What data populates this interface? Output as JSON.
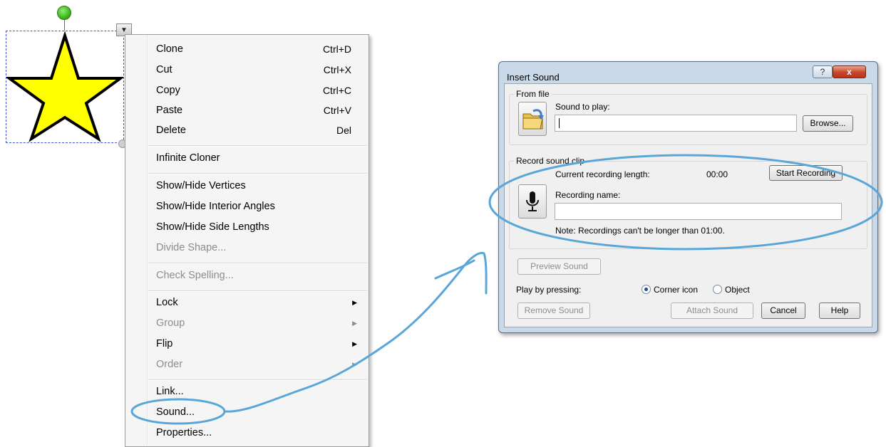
{
  "context_menu": {
    "items": [
      {
        "label": "Clone",
        "shortcut": "Ctrl+D",
        "disabled": false
      },
      {
        "label": "Cut",
        "shortcut": "Ctrl+X",
        "disabled": false
      },
      {
        "label": "Copy",
        "shortcut": "Ctrl+C",
        "disabled": false
      },
      {
        "label": "Paste",
        "shortcut": "Ctrl+V",
        "disabled": false
      },
      {
        "label": "Delete",
        "shortcut": "Del",
        "disabled": false
      },
      {
        "label": "Infinite Cloner",
        "disabled": false
      },
      {
        "label": "Show/Hide Vertices",
        "disabled": false
      },
      {
        "label": "Show/Hide Interior Angles",
        "disabled": false
      },
      {
        "label": "Show/Hide Side Lengths",
        "disabled": false
      },
      {
        "label": "Divide Shape...",
        "disabled": true
      },
      {
        "label": "Check Spelling...",
        "disabled": true
      },
      {
        "label": "Lock",
        "submenu": true,
        "disabled": false
      },
      {
        "label": "Group",
        "submenu": true,
        "disabled": true
      },
      {
        "label": "Flip",
        "submenu": true,
        "disabled": false
      },
      {
        "label": "Order",
        "submenu": true,
        "disabled": true
      },
      {
        "label": "Link...",
        "disabled": false
      },
      {
        "label": "Sound...",
        "disabled": false,
        "highlighted_by_annotation": true
      },
      {
        "label": "Properties...",
        "disabled": false
      }
    ]
  },
  "dialog": {
    "title": "Insert Sound",
    "help_glyph": "?",
    "close_glyph": "x",
    "from_file": {
      "legend": "From file",
      "label": "Sound to play:",
      "value": "",
      "browse_label": "Browse..."
    },
    "record": {
      "legend": "Record sound clip",
      "length_label": "Current recording length:",
      "length_value": "00:00",
      "start_label": "Start Recording",
      "name_label": "Recording name:",
      "name_value": "",
      "note": "Note: Recordings can't be longer than 01:00."
    },
    "preview_label": "Preview Sound",
    "play_by_label": "Play by pressing:",
    "play_options": [
      {
        "label": "Corner icon",
        "selected": true
      },
      {
        "label": "Object",
        "selected": false
      }
    ],
    "remove_label": "Remove Sound",
    "attach_label": "Attach Sound",
    "cancel_label": "Cancel",
    "help_label": "Help"
  },
  "shape": {
    "kind": "star",
    "fill": "#ffff00",
    "stroke": "#000000"
  },
  "menu_handle_glyph": "▼",
  "submenu_glyph": "▶",
  "annotation_color": "#5aa6d8"
}
